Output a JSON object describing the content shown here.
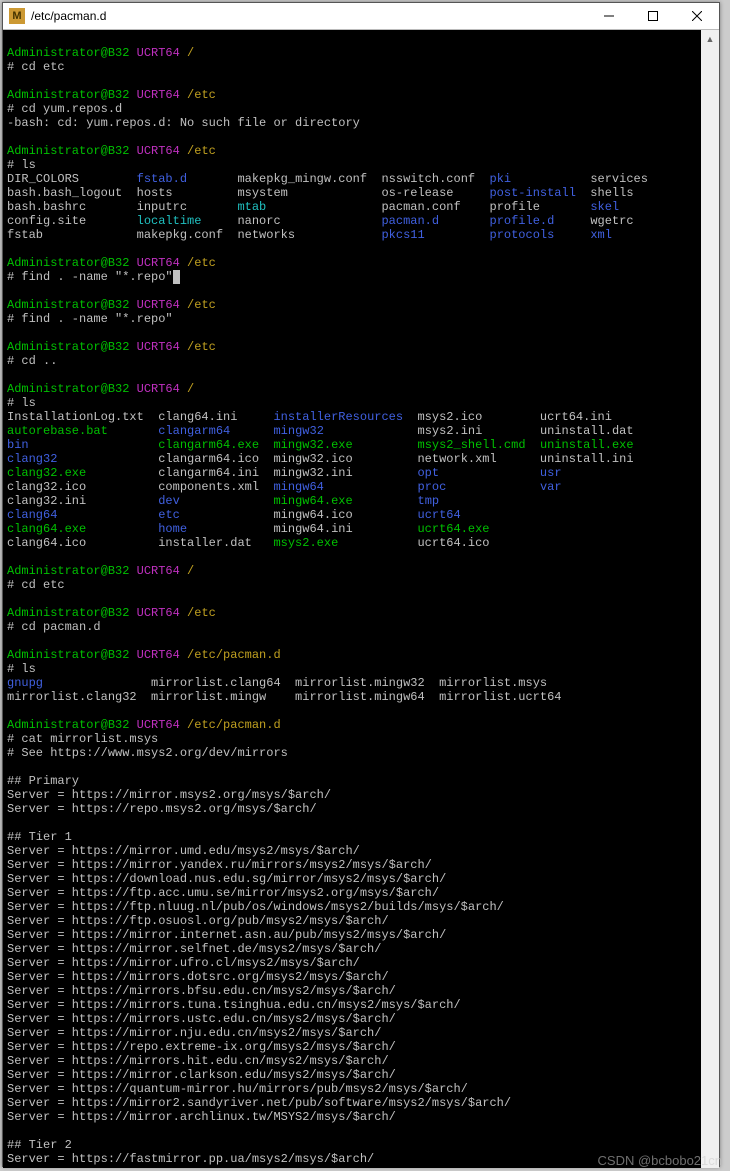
{
  "window": {
    "title": "/etc/pacman.d",
    "iconLetter": "M"
  },
  "prompt": {
    "user": "Administrator@B32",
    "env": "UCRT64"
  },
  "sessions": [
    {
      "path": "/",
      "cmd": "cd etc",
      "out": []
    },
    {
      "path": "/etc",
      "cmd": "cd yum.repos.d",
      "out": [
        "-bash: cd: yum.repos.d: No such file or directory"
      ]
    },
    {
      "path": "/etc",
      "cmd": "ls",
      "out": [],
      "lsEtc": true
    },
    {
      "path": "/etc",
      "cmd": "find . -name \"*.repo\"",
      "cursor": true,
      "out": []
    },
    {
      "path": "/etc",
      "cmd": "find . -name \"*.repo\"",
      "out": []
    },
    {
      "path": "/etc",
      "cmd": "cd ..",
      "out": []
    },
    {
      "path": "/",
      "cmd": "ls",
      "out": [],
      "lsRoot": true
    },
    {
      "path": "/",
      "cmd": "cd etc",
      "out": []
    },
    {
      "path": "/etc",
      "cmd": "cd pacman.d",
      "out": []
    },
    {
      "path": "/etc/pacman.d",
      "cmd": "ls",
      "out": [],
      "lsPacman": true
    },
    {
      "path": "/etc/pacman.d",
      "cmd": "cat mirrorlist.msys",
      "out": [],
      "mirrorlist": true
    }
  ],
  "lsEtc": {
    "rows": [
      [
        "DIR_COLORS",
        "fstab.d",
        "makepkg_mingw.conf",
        "nsswitch.conf",
        "pki",
        "services"
      ],
      [
        "bash.bash_logout",
        "hosts",
        "msystem",
        "os-release",
        "post-install",
        "shells"
      ],
      [
        "bash.bashrc",
        "inputrc",
        "mtab",
        "pacman.conf",
        "profile",
        "skel"
      ],
      [
        "config.site",
        "localtime",
        "nanorc",
        "pacman.d",
        "profile.d",
        "wgetrc"
      ],
      [
        "fstab",
        "makepkg.conf",
        "networks",
        "pkcs11",
        "protocols",
        "xml"
      ]
    ],
    "dirs": [
      "fstab.d",
      "pki",
      "post-install",
      "skel",
      "pacman.d",
      "profile.d",
      "pkcs11",
      "protocols",
      "xml"
    ],
    "links": [
      "mtab",
      "localtime"
    ]
  },
  "lsRoot": {
    "rows": [
      [
        "InstallationLog.txt",
        "clang64.ini",
        "installerResources",
        "msys2.ico",
        "ucrt64.ini"
      ],
      [
        "autorebase.bat",
        "clangarm64",
        "mingw32",
        "msys2.ini",
        "uninstall.dat"
      ],
      [
        "bin",
        "clangarm64.exe",
        "mingw32.exe",
        "msys2_shell.cmd",
        "uninstall.exe"
      ],
      [
        "clang32",
        "clangarm64.ico",
        "mingw32.ico",
        "network.xml",
        "uninstall.ini"
      ],
      [
        "clang32.exe",
        "clangarm64.ini",
        "mingw32.ini",
        "opt",
        "usr"
      ],
      [
        "clang32.ico",
        "components.xml",
        "mingw64",
        "proc",
        "var"
      ],
      [
        "clang32.ini",
        "dev",
        "mingw64.exe",
        "tmp",
        ""
      ],
      [
        "clang64",
        "etc",
        "mingw64.ico",
        "ucrt64",
        ""
      ],
      [
        "clang64.exe",
        "home",
        "mingw64.ini",
        "ucrt64.exe",
        ""
      ],
      [
        "clang64.ico",
        "installer.dat",
        "msys2.exe",
        "ucrt64.ico",
        ""
      ]
    ],
    "dirs": [
      "clangarm64",
      "mingw32",
      "bin",
      "clang32",
      "opt",
      "usr",
      "mingw64",
      "proc",
      "var",
      "dev",
      "tmp",
      "clang64",
      "etc",
      "ucrt64",
      "home",
      "installerResources"
    ],
    "exes": [
      "autorebase.bat",
      "clangarm64.exe",
      "mingw32.exe",
      "msys2_shell.cmd",
      "uninstall.exe",
      "clang32.exe",
      "mingw64.exe",
      "clang64.exe",
      "ucrt64.exe",
      "msys2.exe"
    ]
  },
  "lsPacman": {
    "rows": [
      [
        "gnupg",
        "mirrorlist.clang64",
        "mirrorlist.mingw32",
        "mirrorlist.msys"
      ],
      [
        "mirrorlist.clang32",
        "mirrorlist.mingw",
        "mirrorlist.mingw64",
        "mirrorlist.ucrt64"
      ]
    ],
    "dirs": [
      "gnupg"
    ]
  },
  "mirrorlist": {
    "header": "# See https://www.msys2.org/dev/mirrors",
    "sections": [
      {
        "name": "## Primary",
        "servers": [
          "https://mirror.msys2.org/msys/$arch/",
          "https://repo.msys2.org/msys/$arch/"
        ]
      },
      {
        "name": "## Tier 1",
        "servers": [
          "https://mirror.umd.edu/msys2/msys/$arch/",
          "https://mirror.yandex.ru/mirrors/msys2/msys/$arch/",
          "https://download.nus.edu.sg/mirror/msys2/msys/$arch/",
          "https://ftp.acc.umu.se/mirror/msys2.org/msys/$arch/",
          "https://ftp.nluug.nl/pub/os/windows/msys2/builds/msys/$arch/",
          "https://ftp.osuosl.org/pub/msys2/msys/$arch/",
          "https://mirror.internet.asn.au/pub/msys2/msys/$arch/",
          "https://mirror.selfnet.de/msys2/msys/$arch/",
          "https://mirror.ufro.cl/msys2/msys/$arch/",
          "https://mirrors.dotsrc.org/msys2/msys/$arch/",
          "https://mirrors.bfsu.edu.cn/msys2/msys/$arch/",
          "https://mirrors.tuna.tsinghua.edu.cn/msys2/msys/$arch/",
          "https://mirrors.ustc.edu.cn/msys2/msys/$arch/",
          "https://mirror.nju.edu.cn/msys2/msys/$arch/",
          "https://repo.extreme-ix.org/msys2/msys/$arch/",
          "https://mirrors.hit.edu.cn/msys2/msys/$arch/",
          "https://mirror.clarkson.edu/msys2/msys/$arch/",
          "https://quantum-mirror.hu/mirrors/pub/msys2/msys/$arch/",
          "https://mirror2.sandyriver.net/pub/software/msys2/msys/$arch/",
          "https://mirror.archlinux.tw/MSYS2/msys/$arch/"
        ]
      },
      {
        "name": "## Tier 2",
        "servers": [
          "https://fastmirror.pp.ua/msys2/msys/$arch/"
        ]
      }
    ]
  },
  "watermark": "CSDN @bcbobo21cn"
}
